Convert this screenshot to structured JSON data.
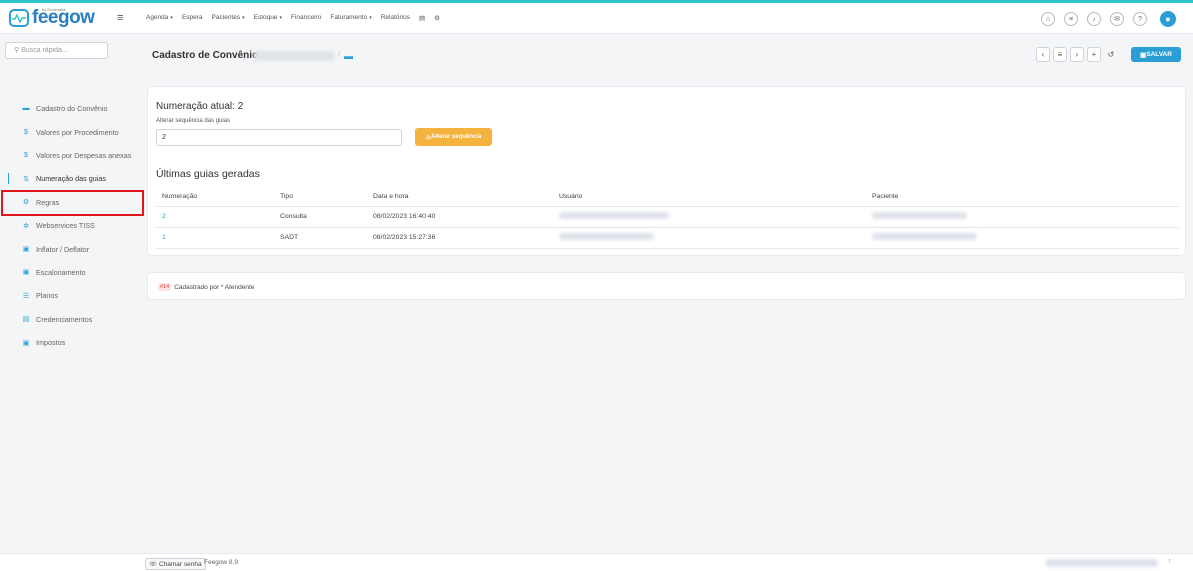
{
  "app": {
    "logo_text": "feegow",
    "logo_by": "by Doctoralia"
  },
  "nav": {
    "items": [
      {
        "label": "Agenda",
        "caret": true
      },
      {
        "label": "Espera",
        "caret": false
      },
      {
        "label": "Pacientes",
        "caret": true
      },
      {
        "label": "Estoque",
        "caret": true
      },
      {
        "label": "Financeiro",
        "caret": false
      },
      {
        "label": "Faturamento",
        "caret": true
      },
      {
        "label": "Relatórios",
        "caret": false
      }
    ]
  },
  "sidebar": {
    "search_placeholder": "Busca rápida...",
    "items": [
      {
        "label": "Cadastro do Convênio",
        "icon": "card-icon"
      },
      {
        "label": "Valores por Procedimento",
        "icon": "dollar-icon"
      },
      {
        "label": "Valores por Despesas anexas",
        "icon": "dollar-icon"
      },
      {
        "label": "Numeração das guias",
        "icon": "sort-icon",
        "active": true
      },
      {
        "label": "Regras",
        "icon": "gears-icon"
      },
      {
        "label": "Webservices TISS",
        "icon": "settings-icon"
      },
      {
        "label": "Inflator / Deflator",
        "icon": "cash-icon"
      },
      {
        "label": "Escalonamento",
        "icon": "cash-icon"
      },
      {
        "label": "Planos",
        "icon": "list-icon"
      },
      {
        "label": "Credenciamentos",
        "icon": "document-icon"
      },
      {
        "label": "Impostos",
        "icon": "cash-icon"
      }
    ]
  },
  "header": {
    "title": "Cadastro de Convênio",
    "save_label": "SALVAR"
  },
  "numeracao": {
    "title": "Numeração atual: 2",
    "alter_label": "Alterar sequência das guias",
    "input_value": "2",
    "button_label": "Alterar sequência"
  },
  "ultimas": {
    "title": "Últimas guias geradas",
    "columns": [
      "Numeração",
      "Tipo",
      "Data e hora",
      "Usuário",
      "Paciente"
    ],
    "rows": [
      {
        "numero": "2",
        "tipo": "Consulta",
        "data": "08/02/2023 16:40:40"
      },
      {
        "numero": "1",
        "tipo": "SADT",
        "data": "08/02/2023 15:27:36"
      }
    ]
  },
  "cadastro": {
    "badge": "#14",
    "text": "Cadastrado por * Atendente"
  },
  "footer": {
    "chamar": "Chamar senha",
    "version": "Feegow 8.9"
  }
}
